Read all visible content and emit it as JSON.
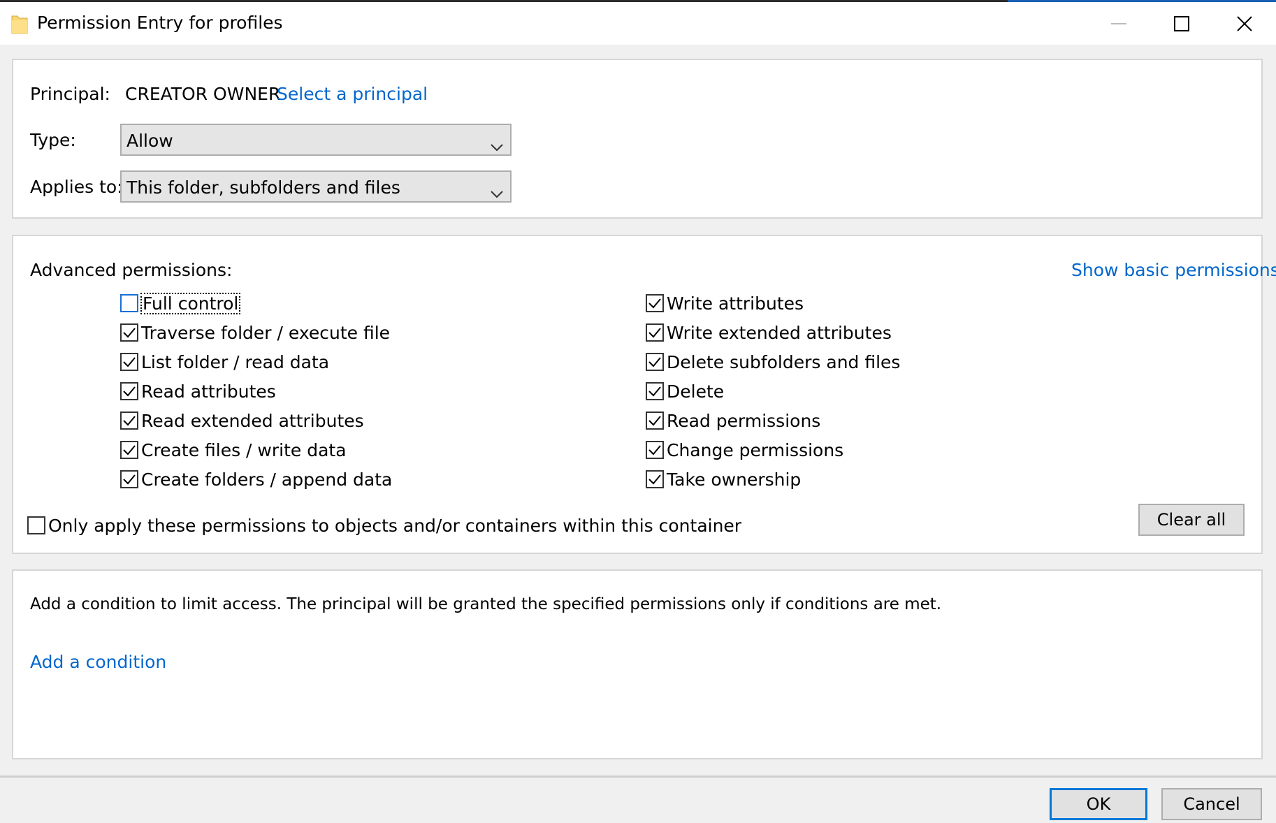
{
  "window": {
    "title": "Permission Entry for profiles",
    "folder_icon": "folder-icon",
    "controls": [
      "minimize-icon",
      "maximize-icon",
      "close-icon"
    ]
  },
  "principal": {
    "label": "Principal:",
    "value": "CREATOR OWNER",
    "select_link": "Select a principal"
  },
  "type": {
    "label": "Type:",
    "value": "Allow"
  },
  "applies_to": {
    "label": "Applies to:",
    "value": "This folder, subfolders and files"
  },
  "advanced": {
    "label": "Advanced permissions:",
    "show_basic_link": "Show basic permissions",
    "left": [
      {
        "label": "Full control",
        "checked": false
      },
      {
        "label": "Traverse folder / execute file",
        "checked": true
      },
      {
        "label": "List folder / read data",
        "checked": true
      },
      {
        "label": "Read attributes",
        "checked": true
      },
      {
        "label": "Read extended attributes",
        "checked": true
      },
      {
        "label": "Create files / write data",
        "checked": true
      },
      {
        "label": "Create folders / append data",
        "checked": true
      }
    ],
    "right": [
      {
        "label": "Write attributes",
        "checked": true
      },
      {
        "label": "Write extended attributes",
        "checked": true
      },
      {
        "label": "Delete subfolders and files",
        "checked": true
      },
      {
        "label": "Delete",
        "checked": true
      },
      {
        "label": "Read permissions",
        "checked": true
      },
      {
        "label": "Change permissions",
        "checked": true
      },
      {
        "label": "Take ownership",
        "checked": true
      }
    ],
    "only_apply": {
      "label": "Only apply these permissions to objects and/or containers within this container",
      "checked": false
    },
    "clear_all": "Clear all"
  },
  "condition": {
    "description": "Add a condition to limit access. The principal will be granted the specified permissions only if conditions are met.",
    "add_link": "Add a condition"
  },
  "footer": {
    "ok": "OK",
    "cancel": "Cancel"
  },
  "colors": {
    "link": "#0066cc",
    "focus_blue": "#0078d7",
    "folder": "#f8d775"
  }
}
